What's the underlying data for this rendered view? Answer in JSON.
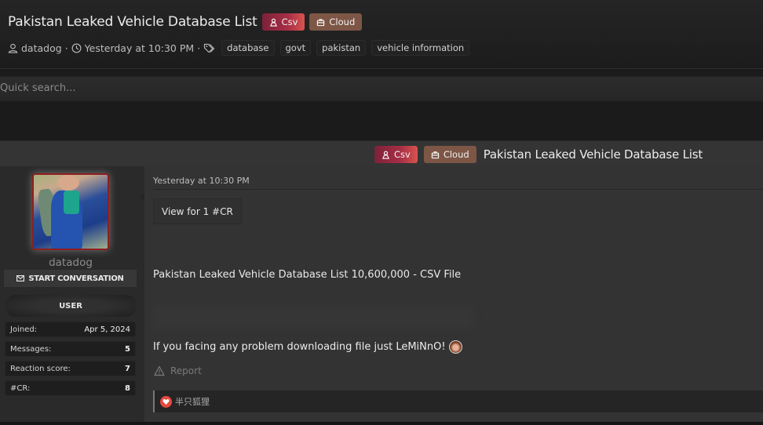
{
  "thread": {
    "title": "Pakistan Leaked Vehicle Database List",
    "labels": [
      {
        "text": "Csv",
        "icon": "user-secret-icon",
        "color": "#a72e45"
      },
      {
        "text": "Cloud",
        "icon": "briefcase-icon",
        "color": "#7d5646"
      }
    ],
    "author": "datadog",
    "date": "Yesterday at 10:30 PM",
    "tags": [
      "database",
      "govt",
      "pakistan",
      "vehicle information"
    ]
  },
  "search": {
    "placeholder": "Quick search..."
  },
  "post": {
    "title": "Pakistan Leaked Vehicle Database List",
    "date": "Yesterday at 10:30 PM",
    "view_button": "View for 1 #CR",
    "body_line1": "Pakistan Leaked Vehicle Database List 10,600,000 - CSV File",
    "body_line2": "If you facing any problem downloading file just LeMiNnO!",
    "report_label": "Report",
    "reaction_user": "半只狐狸"
  },
  "user": {
    "name": "datadog",
    "start_conversation": "START CONVERSATION",
    "title": "USER",
    "stats": [
      {
        "label": "Joined:",
        "value": "Apr 5, 2024"
      },
      {
        "label": "Messages:",
        "value": "5"
      },
      {
        "label": "Reaction score:",
        "value": "7"
      },
      {
        "label": "#CR:",
        "value": "8"
      }
    ]
  }
}
